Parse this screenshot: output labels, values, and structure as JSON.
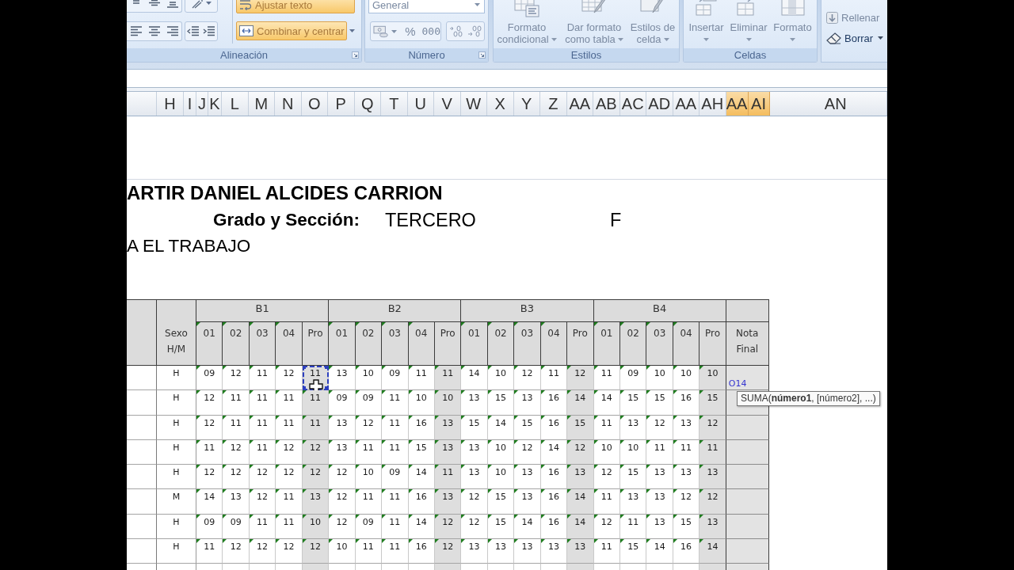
{
  "ribbon": {
    "alignment": {
      "label": "Alineación",
      "wrap_text": {
        "label": "Ajustar texto",
        "pressed": true,
        "disabled": true
      },
      "merge": {
        "label": "Combinar y centrar",
        "pressed": true,
        "disabled": true
      }
    },
    "number": {
      "label": "Número",
      "format": {
        "value": "General",
        "disabled": true
      },
      "percent": "%",
      "thousands": "000",
      "disabled": true
    },
    "styles": {
      "label": "Estilos",
      "buttons": [
        {
          "kind": "conditional",
          "lines": [
            "Formato",
            "condicional"
          ],
          "disabled": true
        },
        {
          "kind": "table",
          "lines": [
            "Dar formato",
            "como tabla"
          ],
          "disabled": true
        },
        {
          "kind": "cell",
          "lines": [
            "Estilos de",
            "celda"
          ],
          "disabled": true
        }
      ]
    },
    "cells": {
      "label": "Celdas",
      "buttons": [
        {
          "kind": "insert",
          "label": "Insertar",
          "disabled": true
        },
        {
          "kind": "delete",
          "label": "Eliminar",
          "disabled": true
        },
        {
          "kind": "format",
          "label": "Formato",
          "disabled": true
        }
      ]
    },
    "editing": {
      "buttons": [
        {
          "kind": "fill",
          "label": "Rellenar",
          "disabled": true
        },
        {
          "kind": "clear",
          "label": "Borrar",
          "disabled": false
        }
      ]
    }
  },
  "column_headers": [
    {
      "label": "H",
      "selected": false
    },
    {
      "label": "I",
      "selected": false
    },
    {
      "label": "J",
      "selected": false
    },
    {
      "label": "K",
      "selected": false
    },
    {
      "label": "L",
      "selected": false
    },
    {
      "label": "M",
      "selected": false
    },
    {
      "label": "N",
      "selected": false
    },
    {
      "label": "O",
      "selected": false
    },
    {
      "label": "P",
      "selected": false
    },
    {
      "label": "Q",
      "selected": false
    },
    {
      "label": "T",
      "selected": false
    },
    {
      "label": "U",
      "selected": false
    },
    {
      "label": "V",
      "selected": false
    },
    {
      "label": "W",
      "selected": false
    },
    {
      "label": "X",
      "selected": false
    },
    {
      "label": "Y",
      "selected": false
    },
    {
      "label": "Z",
      "selected": false
    },
    {
      "label": "AA",
      "selected": false
    },
    {
      "label": "AB",
      "selected": false
    },
    {
      "label": "AC",
      "selected": false
    },
    {
      "label": "AD",
      "selected": false
    },
    {
      "label": "AA",
      "selected": false
    },
    {
      "label": "AH",
      "selected": false
    },
    {
      "label": "AA",
      "selected": true
    },
    {
      "label": "AI",
      "selected": true
    },
    {
      "label": "AN",
      "selected": false
    }
  ],
  "sheet": {
    "title": "ARTIR DANIEL ALCIDES CARRION",
    "grade_label": "Grado y Sección:",
    "grade_value": "TERCERO",
    "section": "F",
    "subtitle": "A EL TRABAJO"
  },
  "table": {
    "sex_header": "Sexo H/M",
    "blocks": [
      {
        "label": "B1",
        "columns": [
          "01",
          "02",
          "03",
          "04",
          "Pro"
        ]
      },
      {
        "label": "B2",
        "columns": [
          "01",
          "02",
          "03",
          "04",
          "Pro"
        ]
      },
      {
        "label": "B3",
        "columns": [
          "01",
          "02",
          "03",
          "04",
          "Pro"
        ]
      },
      {
        "label": "B4",
        "columns": [
          "01",
          "02",
          "03",
          "04",
          "Pro"
        ]
      }
    ],
    "final_header": "Nota Final",
    "rows": [
      {
        "sex": "H",
        "final": "O14",
        "cells": [
          {
            "value": "09",
            "selected": false
          },
          {
            "value": "12",
            "selected": false
          },
          {
            "value": "11",
            "selected": false
          },
          {
            "value": "12",
            "selected": false
          },
          {
            "value": "11",
            "selected": true
          },
          {
            "value": "13",
            "selected": false
          },
          {
            "value": "10",
            "selected": false
          },
          {
            "value": "09",
            "selected": false
          },
          {
            "value": "11",
            "selected": false
          },
          {
            "value": "11",
            "selected": false
          },
          {
            "value": "14",
            "selected": false
          },
          {
            "value": "10",
            "selected": false
          },
          {
            "value": "12",
            "selected": false
          },
          {
            "value": "11",
            "selected": false
          },
          {
            "value": "12",
            "selected": false
          },
          {
            "value": "11",
            "selected": false
          },
          {
            "value": "09",
            "selected": false
          },
          {
            "value": "10",
            "selected": false
          },
          {
            "value": "10",
            "selected": false
          },
          {
            "value": "10",
            "selected": false
          }
        ]
      },
      {
        "sex": "H",
        "cells": [
          {
            "value": "12",
            "selected": false
          },
          {
            "value": "11",
            "selected": false
          },
          {
            "value": "11",
            "selected": false
          },
          {
            "value": "11",
            "selected": false
          },
          {
            "value": "11",
            "selected": false
          },
          {
            "value": "09",
            "selected": false
          },
          {
            "value": "09",
            "selected": false
          },
          {
            "value": "11",
            "selected": false
          },
          {
            "value": "10",
            "selected": false
          },
          {
            "value": "10",
            "selected": false
          },
          {
            "value": "13",
            "selected": false
          },
          {
            "value": "15",
            "selected": false
          },
          {
            "value": "13",
            "selected": false
          },
          {
            "value": "16",
            "selected": false
          },
          {
            "value": "14",
            "selected": false
          },
          {
            "value": "14",
            "selected": false
          },
          {
            "value": "15",
            "selected": false
          },
          {
            "value": "15",
            "selected": false
          },
          {
            "value": "16",
            "selected": false
          },
          {
            "value": "15",
            "selected": false
          }
        ]
      },
      {
        "sex": "H",
        "cells": [
          {
            "value": "12",
            "selected": false
          },
          {
            "value": "11",
            "selected": false
          },
          {
            "value": "11",
            "selected": false
          },
          {
            "value": "11",
            "selected": false
          },
          {
            "value": "11",
            "selected": false
          },
          {
            "value": "13",
            "selected": false
          },
          {
            "value": "12",
            "selected": false
          },
          {
            "value": "11",
            "selected": false
          },
          {
            "value": "16",
            "selected": false
          },
          {
            "value": "13",
            "selected": false
          },
          {
            "value": "15",
            "selected": false
          },
          {
            "value": "14",
            "selected": false
          },
          {
            "value": "15",
            "selected": false
          },
          {
            "value": "16",
            "selected": false
          },
          {
            "value": "15",
            "selected": false
          },
          {
            "value": "11",
            "selected": false
          },
          {
            "value": "13",
            "selected": false
          },
          {
            "value": "12",
            "selected": false
          },
          {
            "value": "13",
            "selected": false
          },
          {
            "value": "12",
            "selected": false
          }
        ]
      },
      {
        "sex": "H",
        "cells": [
          {
            "value": "11",
            "selected": false
          },
          {
            "value": "12",
            "selected": false
          },
          {
            "value": "11",
            "selected": false
          },
          {
            "value": "12",
            "selected": false
          },
          {
            "value": "12",
            "selected": false
          },
          {
            "value": "13",
            "selected": false
          },
          {
            "value": "11",
            "selected": false
          },
          {
            "value": "11",
            "selected": false
          },
          {
            "value": "15",
            "selected": false
          },
          {
            "value": "13",
            "selected": false
          },
          {
            "value": "13",
            "selected": false
          },
          {
            "value": "10",
            "selected": false
          },
          {
            "value": "12",
            "selected": false
          },
          {
            "value": "14",
            "selected": false
          },
          {
            "value": "12",
            "selected": false
          },
          {
            "value": "10",
            "selected": false
          },
          {
            "value": "10",
            "selected": false
          },
          {
            "value": "11",
            "selected": false
          },
          {
            "value": "11",
            "selected": false
          },
          {
            "value": "11",
            "selected": false
          }
        ]
      },
      {
        "sex": "H",
        "cells": [
          {
            "value": "12",
            "selected": false
          },
          {
            "value": "12",
            "selected": false
          },
          {
            "value": "12",
            "selected": false
          },
          {
            "value": "12",
            "selected": false
          },
          {
            "value": "12",
            "selected": false
          },
          {
            "value": "12",
            "selected": false
          },
          {
            "value": "10",
            "selected": false
          },
          {
            "value": "09",
            "selected": false
          },
          {
            "value": "14",
            "selected": false
          },
          {
            "value": "11",
            "selected": false
          },
          {
            "value": "13",
            "selected": false
          },
          {
            "value": "10",
            "selected": false
          },
          {
            "value": "13",
            "selected": false
          },
          {
            "value": "16",
            "selected": false
          },
          {
            "value": "13",
            "selected": false
          },
          {
            "value": "12",
            "selected": false
          },
          {
            "value": "15",
            "selected": false
          },
          {
            "value": "13",
            "selected": false
          },
          {
            "value": "13",
            "selected": false
          },
          {
            "value": "13",
            "selected": false
          }
        ]
      },
      {
        "sex": "M",
        "cells": [
          {
            "value": "14",
            "selected": false
          },
          {
            "value": "13",
            "selected": false
          },
          {
            "value": "12",
            "selected": false
          },
          {
            "value": "11",
            "selected": false
          },
          {
            "value": "13",
            "selected": false
          },
          {
            "value": "12",
            "selected": false
          },
          {
            "value": "11",
            "selected": false
          },
          {
            "value": "11",
            "selected": false
          },
          {
            "value": "16",
            "selected": false
          },
          {
            "value": "13",
            "selected": false
          },
          {
            "value": "12",
            "selected": false
          },
          {
            "value": "15",
            "selected": false
          },
          {
            "value": "13",
            "selected": false
          },
          {
            "value": "16",
            "selected": false
          },
          {
            "value": "14",
            "selected": false
          },
          {
            "value": "11",
            "selected": false
          },
          {
            "value": "13",
            "selected": false
          },
          {
            "value": "13",
            "selected": false
          },
          {
            "value": "12",
            "selected": false
          },
          {
            "value": "12",
            "selected": false
          }
        ]
      },
      {
        "sex": "H",
        "cells": [
          {
            "value": "09",
            "selected": false
          },
          {
            "value": "09",
            "selected": false
          },
          {
            "value": "11",
            "selected": false
          },
          {
            "value": "11",
            "selected": false
          },
          {
            "value": "10",
            "selected": false
          },
          {
            "value": "12",
            "selected": false
          },
          {
            "value": "09",
            "selected": false
          },
          {
            "value": "11",
            "selected": false
          },
          {
            "value": "14",
            "selected": false
          },
          {
            "value": "12",
            "selected": false
          },
          {
            "value": "12",
            "selected": false
          },
          {
            "value": "15",
            "selected": false
          },
          {
            "value": "14",
            "selected": false
          },
          {
            "value": "16",
            "selected": false
          },
          {
            "value": "14",
            "selected": false
          },
          {
            "value": "12",
            "selected": false
          },
          {
            "value": "11",
            "selected": false
          },
          {
            "value": "13",
            "selected": false
          },
          {
            "value": "15",
            "selected": false
          },
          {
            "value": "13",
            "selected": false
          }
        ]
      },
      {
        "sex": "H",
        "cells": [
          {
            "value": "11",
            "selected": false
          },
          {
            "value": "12",
            "selected": false
          },
          {
            "value": "12",
            "selected": false
          },
          {
            "value": "12",
            "selected": false
          },
          {
            "value": "12",
            "selected": false
          },
          {
            "value": "10",
            "selected": false
          },
          {
            "value": "11",
            "selected": false
          },
          {
            "value": "11",
            "selected": false
          },
          {
            "value": "16",
            "selected": false
          },
          {
            "value": "12",
            "selected": false
          },
          {
            "value": "13",
            "selected": false
          },
          {
            "value": "13",
            "selected": false
          },
          {
            "value": "13",
            "selected": false
          },
          {
            "value": "13",
            "selected": false
          },
          {
            "value": "13",
            "selected": false
          },
          {
            "value": "11",
            "selected": false
          },
          {
            "value": "15",
            "selected": false
          },
          {
            "value": "14",
            "selected": false
          },
          {
            "value": "16",
            "selected": false
          },
          {
            "value": "14",
            "selected": false
          }
        ]
      }
    ]
  },
  "tooltip": "SUMA(**número1**, [número2], ...)"
}
